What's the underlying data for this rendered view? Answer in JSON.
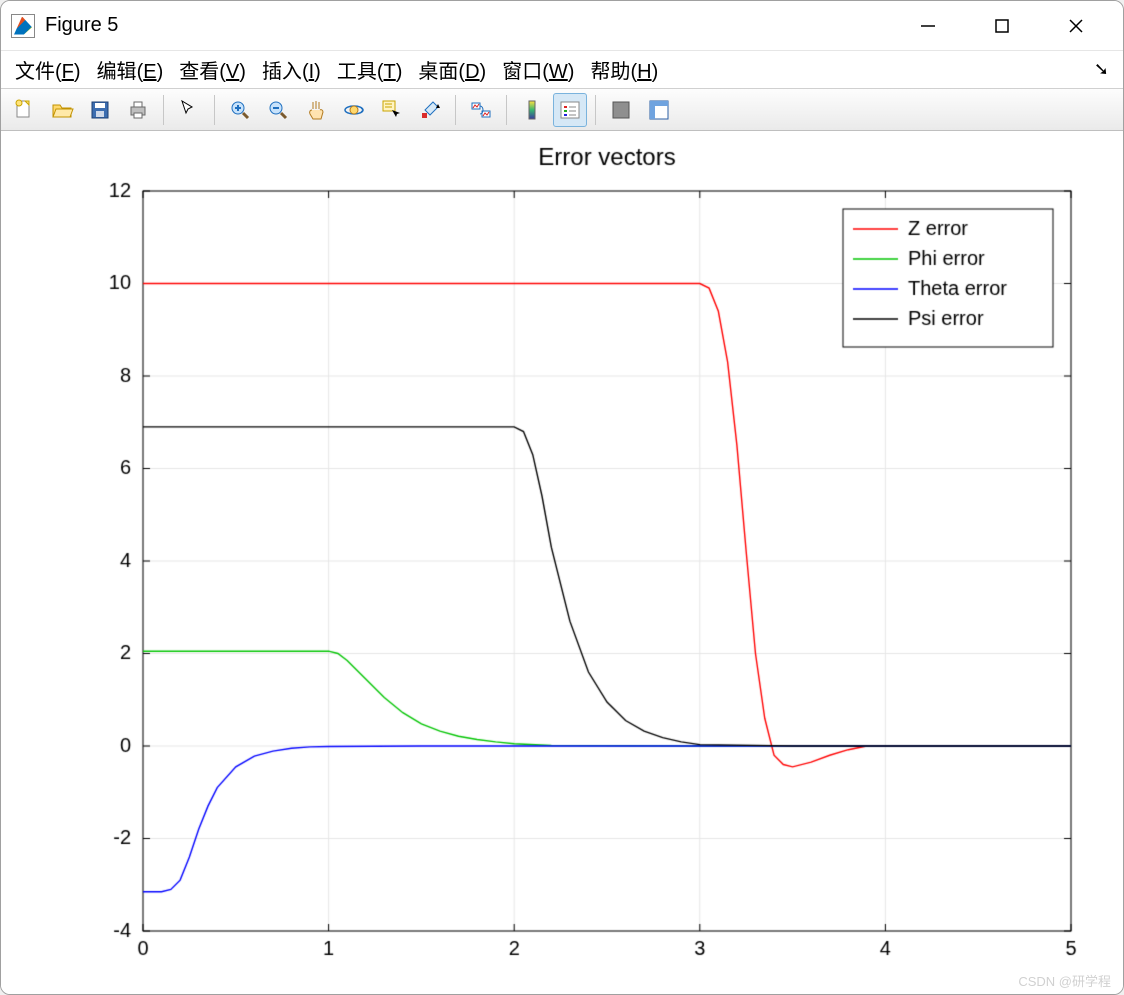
{
  "window": {
    "title": "Figure 5"
  },
  "menus": {
    "file": {
      "label": "文件",
      "key": "F"
    },
    "edit": {
      "label": "编辑",
      "key": "E"
    },
    "view": {
      "label": "查看",
      "key": "V"
    },
    "insert": {
      "label": "插入",
      "key": "I"
    },
    "tools": {
      "label": "工具",
      "key": "T"
    },
    "desktop": {
      "label": "桌面",
      "key": "D"
    },
    "window": {
      "label": "窗口",
      "key": "W"
    },
    "help": {
      "label": "帮助",
      "key": "H"
    }
  },
  "toolbar": {
    "new": "new-figure",
    "open": "open",
    "save": "save",
    "print": "print",
    "pointer": "edit-plot",
    "zoomin": "zoom-in",
    "zoomout": "zoom-out",
    "pan": "pan",
    "rotate": "rotate-3d",
    "datatips": "data-cursor",
    "brush": "brush",
    "link": "link",
    "colorbar": "insert-colorbar",
    "legend": "insert-legend",
    "hide": "hide-plot-tools",
    "dock": "dock-figure"
  },
  "watermark": "CSDN @研学程",
  "chart_data": {
    "type": "line",
    "title": "Error vectors",
    "xlabel": "",
    "ylabel": "",
    "xlim": [
      0,
      5
    ],
    "ylim": [
      -4,
      12
    ],
    "xticks": [
      0,
      1,
      2,
      3,
      4,
      5
    ],
    "yticks": [
      -4,
      -2,
      0,
      2,
      4,
      6,
      8,
      10,
      12
    ],
    "legend_position": "northeast",
    "series": [
      {
        "name": "Z error",
        "color": "#ff0000",
        "x": [
          0,
          0.1,
          1.0,
          2.0,
          3.0,
          3.05,
          3.1,
          3.15,
          3.2,
          3.25,
          3.3,
          3.35,
          3.4,
          3.45,
          3.5,
          3.6,
          3.7,
          3.8,
          3.9,
          4.0,
          4.5,
          5.0
        ],
        "y": [
          10.0,
          10.0,
          10.0,
          10.0,
          10.0,
          9.9,
          9.4,
          8.3,
          6.5,
          4.2,
          2.0,
          0.6,
          -0.2,
          -0.4,
          -0.45,
          -0.35,
          -0.2,
          -0.08,
          0.0,
          0.0,
          0.0,
          0.0
        ]
      },
      {
        "name": "Phi error",
        "color": "#00c400",
        "x": [
          0,
          0.1,
          0.5,
          1.0,
          1.05,
          1.1,
          1.2,
          1.3,
          1.4,
          1.5,
          1.6,
          1.7,
          1.8,
          1.9,
          2.0,
          2.2,
          3.0,
          5.0
        ],
        "y": [
          2.05,
          2.05,
          2.05,
          2.05,
          2.0,
          1.85,
          1.45,
          1.05,
          0.72,
          0.48,
          0.32,
          0.21,
          0.14,
          0.09,
          0.05,
          0.01,
          0.0,
          0.0
        ]
      },
      {
        "name": "Theta error",
        "color": "#0000ff",
        "x": [
          0,
          0.1,
          0.15,
          0.2,
          0.25,
          0.3,
          0.35,
          0.4,
          0.5,
          0.6,
          0.7,
          0.8,
          0.9,
          1.0,
          1.5,
          5.0
        ],
        "y": [
          -3.15,
          -3.15,
          -3.1,
          -2.9,
          -2.4,
          -1.8,
          -1.3,
          -0.9,
          -0.45,
          -0.22,
          -0.11,
          -0.05,
          -0.02,
          -0.01,
          0.0,
          0.0
        ]
      },
      {
        "name": "Psi error",
        "color": "#000000",
        "x": [
          0,
          0.1,
          1.0,
          2.0,
          2.05,
          2.1,
          2.15,
          2.2,
          2.3,
          2.4,
          2.5,
          2.6,
          2.7,
          2.8,
          2.9,
          3.0,
          3.5,
          5.0
        ],
        "y": [
          6.9,
          6.9,
          6.9,
          6.9,
          6.8,
          6.3,
          5.4,
          4.3,
          2.7,
          1.6,
          0.95,
          0.55,
          0.32,
          0.18,
          0.09,
          0.03,
          0.0,
          0.0
        ]
      }
    ]
  }
}
